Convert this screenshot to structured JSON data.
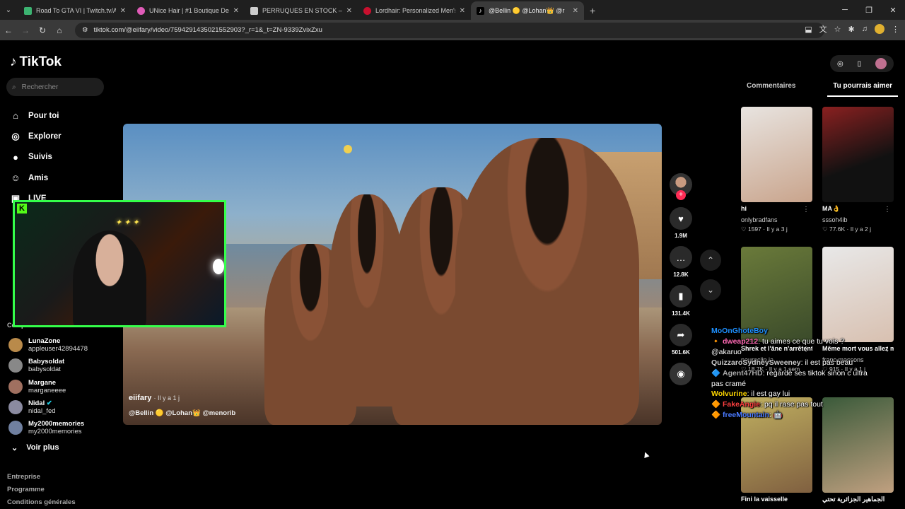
{
  "browser": {
    "tabs": [
      {
        "title": "Road To GTA VI | Twitch.tv/Akan",
        "color": "#3cb371"
      },
      {
        "title": "UNice Hair | #1 Boutique De Ha",
        "color": "#e05bb8"
      },
      {
        "title": "PERRUQUES EN STOCK – Glam",
        "color": "#cccccc"
      },
      {
        "title": "Lordhair: Personalized Men's H",
        "color": "#c8102e"
      },
      {
        "title": "@Bellin 🟡 @Lohan👑 @r",
        "color": "#ffffff"
      }
    ],
    "url": "tiktok.com/@eiifary/video/7594291435021552903?_r=1&_t=ZN-9339ZvixZxu"
  },
  "sidebar": {
    "logo": "TikTok",
    "search_placeholder": "Rechercher",
    "nav": [
      {
        "label": "Pour toi",
        "icon": "home-icon",
        "glyph": "⌂"
      },
      {
        "label": "Explorer",
        "icon": "compass-icon",
        "glyph": "◎"
      },
      {
        "label": "Suivis",
        "icon": "following-icon",
        "glyph": "●"
      },
      {
        "label": "Amis",
        "icon": "friends-icon",
        "glyph": "☺"
      },
      {
        "label": "LIVE",
        "icon": "live-icon",
        "glyph": "▣"
      }
    ],
    "followed_heading": "Comptes suivis",
    "accounts": [
      {
        "name": "LunaZone",
        "handle": "appleuser42894478",
        "color": "#b98a4a"
      },
      {
        "name": "Babysoldat",
        "handle": "babysoldat",
        "color": "#888888"
      },
      {
        "name": "Margane",
        "handle": "marganeeee",
        "color": "#a07060"
      },
      {
        "name": "Nidal",
        "handle": "nidal_fed",
        "color": "#8a8aa0"
      },
      {
        "name": "My2000memories",
        "handle": "my2000memories",
        "color": "#7080a0"
      }
    ],
    "see_more": "Voir plus",
    "footer": [
      "Entreprise",
      "Programme",
      "Conditions générales"
    ]
  },
  "video": {
    "username": "eiifary",
    "date": "· Il y a 1 j",
    "tags": "@Bellin 🟡 @Lohan👑 @menorib"
  },
  "actions": [
    {
      "icon": "heart-icon",
      "glyph": "♥",
      "count": "1.9M"
    },
    {
      "icon": "comment-icon",
      "glyph": "…",
      "count": "12.8K"
    },
    {
      "icon": "bookmark-icon",
      "glyph": "▮",
      "count": "131.4K"
    },
    {
      "icon": "share-icon",
      "glyph": "➦",
      "count": "501.6K"
    }
  ],
  "right": {
    "tabs": [
      "Commentaires",
      "Tu pourrais aimer"
    ],
    "cards": [
      {
        "caption": "hi",
        "author": "onlybradfans",
        "stats": "♡ 1597 · Il y a 3 j",
        "c1": "#c9a48c",
        "c2": "#e8e4e0"
      },
      {
        "caption": "MA👌",
        "author": "sssoh4ib",
        "stats": "♡ 77.6K · Il y a 2 j",
        "c1": "#111111",
        "c2": "#8a2020"
      },
      {
        "caption": "Shrek et l'âne n'arrêtent pas de ...",
        "author": "neuraclip.ia",
        "stats": "♡ 18.7K · Il y a 1 sem",
        "c1": "#6a7a3a",
        "c2": "#3a4a2a"
      },
      {
        "caption": "Même mort vous allez me subir...",
        "author": "franc.massons",
        "stats": "♡ 915 · Il y a 1 j",
        "c1": "#d8c0b0",
        "c2": "#e8e8e8"
      },
      {
        "caption": "Fini la vaisselle",
        "author": "",
        "stats": "",
        "c1": "#c0b060",
        "c2": "#806040"
      },
      {
        "caption": "الجماهير الجزائرية تحتي",
        "author": "",
        "stats": "",
        "c1": "#3a5a3a",
        "c2": "#c0a080"
      }
    ]
  },
  "chat": [
    {
      "user": "MoOnGhoteBoy",
      "color": "#1e90ff",
      "text": ""
    },
    {
      "user": "dweap212",
      "color": "#ff69b4",
      "text": ": tu aimes ce que tu vois ? @akaruo"
    },
    {
      "user": "QuizzaroSydneySweeney",
      "color": "#cccccc",
      "text": ": il est pas beau"
    },
    {
      "user": "Agent47HD",
      "color": "#aaaaaa",
      "text": ": regarde ses tiktok sinon c ultra pas cramé"
    },
    {
      "user": "Wolvurine",
      "color": "#ffd700",
      "text": ": il est gay lui"
    },
    {
      "user": "FakeAngie",
      "color": "#ff4040",
      "text": ": pq il rase pas tout"
    },
    {
      "user": "freeMountain",
      "color": "#4a7aff",
      "text": ": 🤖"
    }
  ]
}
